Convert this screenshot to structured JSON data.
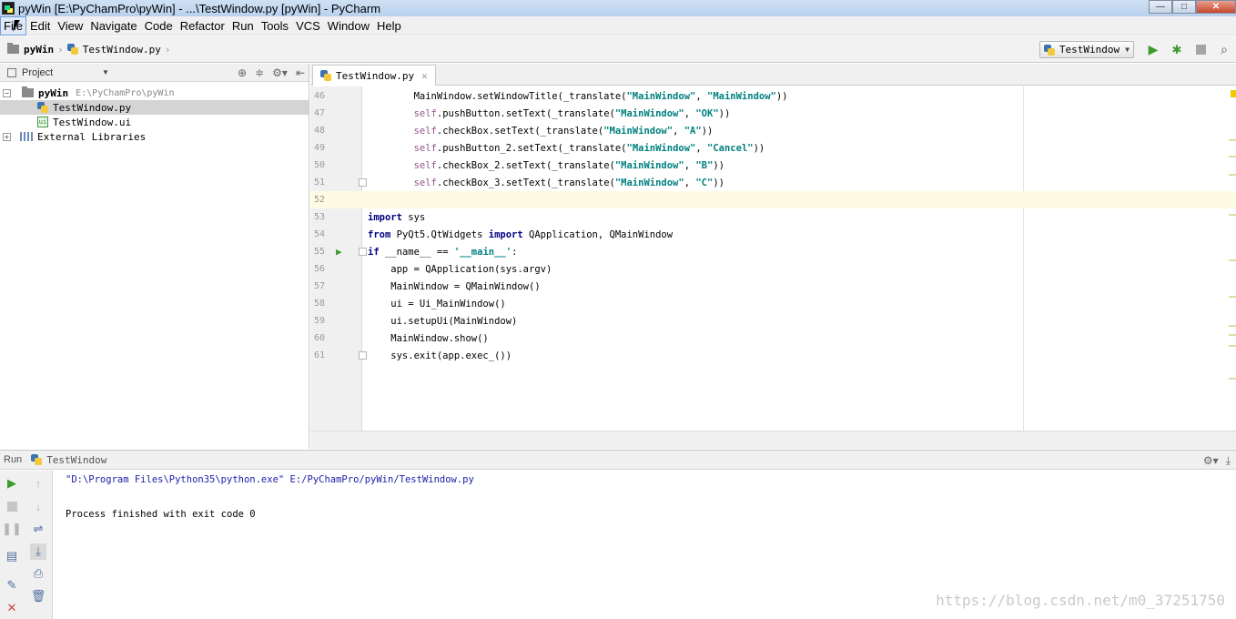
{
  "window": {
    "title": "pyWin [E:\\PyChamPro\\pyWin] - ...\\TestWindow.py [pyWin] - PyCharm",
    "controls": [
      "minimize-icon",
      "maximize-icon",
      "close-icon"
    ]
  },
  "menu": [
    "File",
    "Edit",
    "View",
    "Navigate",
    "Code",
    "Refactor",
    "Run",
    "Tools",
    "VCS",
    "Window",
    "Help"
  ],
  "breadcrumb": {
    "project": "pyWin",
    "file": "TestWindow.py"
  },
  "toolbar": {
    "run_config": "TestWindow"
  },
  "project_panel": {
    "header": "Project",
    "tree": [
      {
        "label": "pyWin",
        "path": "E:\\PyChamPro\\pyWin"
      },
      {
        "label": "TestWindow.py"
      },
      {
        "label": "TestWindow.ui"
      },
      {
        "label": "External Libraries"
      }
    ]
  },
  "editor": {
    "tab": "TestWindow.py",
    "lines": [
      {
        "n": "46"
      },
      {
        "n": "47"
      },
      {
        "n": "48"
      },
      {
        "n": "49"
      },
      {
        "n": "50"
      },
      {
        "n": "51"
      },
      {
        "n": "52"
      },
      {
        "n": "53"
      },
      {
        "n": "54"
      },
      {
        "n": "55"
      },
      {
        "n": "56"
      },
      {
        "n": "57"
      },
      {
        "n": "58"
      },
      {
        "n": "59"
      },
      {
        "n": "60"
      },
      {
        "n": "61"
      }
    ]
  },
  "run_panel": {
    "label": "Run",
    "config": "TestWindow",
    "output": [
      "\"D:\\Program Files\\Python35\\python.exe\" E:/PyChamPro/pyWin/TestWindow.py",
      "Process finished with exit code 0"
    ]
  },
  "watermark": "https://blog.csdn.net/m0_37251750",
  "colors": {
    "keyword": "#000080",
    "string": "#008080",
    "self": "#94558d",
    "run_green": "#3d9a2e"
  }
}
